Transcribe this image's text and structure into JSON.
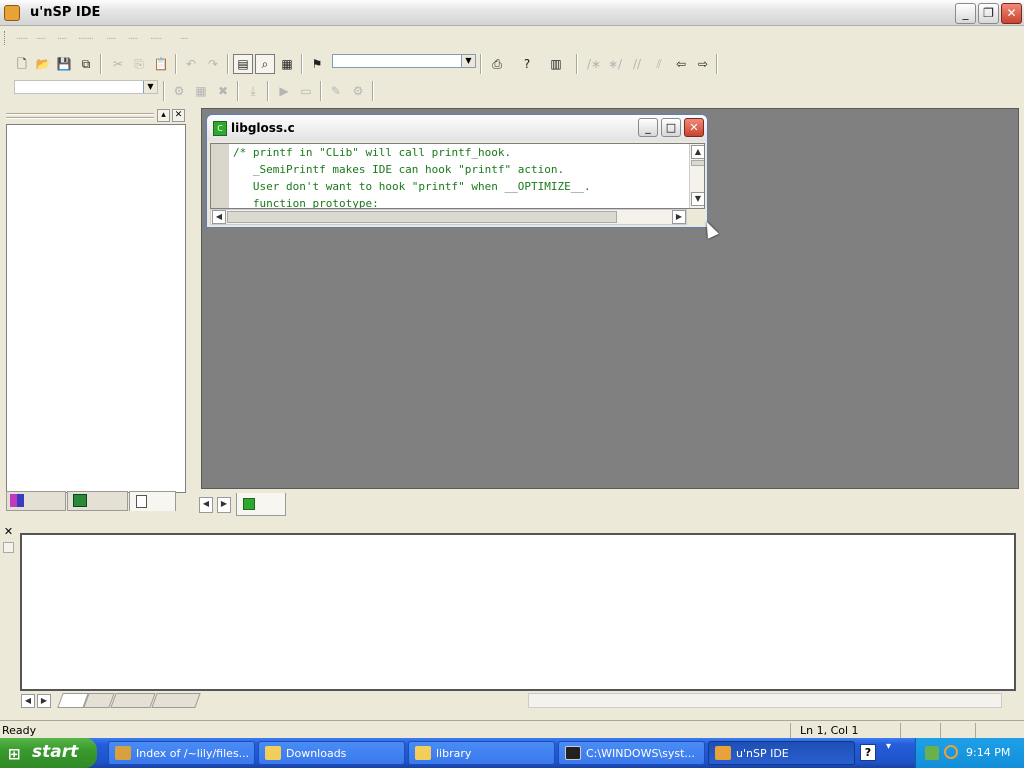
{
  "window": {
    "title": "u'nSP IDE"
  },
  "menubar": {
    "items": [
      "......",
      ".....",
      ".....",
      "........",
      ".....",
      ".....",
      "......",
      "...."
    ]
  },
  "toolbar1": {
    "icons": [
      "new-icon",
      "open-icon",
      "save-icon",
      "save-all-icon",
      "cut-icon",
      "copy-icon",
      "paste-icon",
      "undo-icon",
      "redo-icon",
      "workspace-icon",
      "find-in-files-icon",
      "output-icon",
      "bookmark-icon",
      "print-icon",
      "help-icon",
      "chart-icon",
      "comment-icon",
      "uncomment-icon",
      "indent-icon",
      "outdent-icon",
      "back-icon",
      "forward-icon"
    ]
  },
  "editor": {
    "filename": "libgloss.c",
    "file_icon": "C",
    "lines": [
      "/* printf in \"CLib\" will call printf_hook.",
      "   _SemiPrintf makes IDE can hook \"printf\" action.",
      "   User don't want to hook \"printf\" when __OPTIMIZE__.",
      "   function prototype:"
    ]
  },
  "status": {
    "text": "Ready",
    "position": "Ln 1, Col 1"
  },
  "taskbar": {
    "start_label": "start",
    "tasks": [
      {
        "label": "Index of /~lily/files..."
      },
      {
        "label": "Downloads"
      },
      {
        "label": "library"
      },
      {
        "label": "C:\\WINDOWS\\syst..."
      },
      {
        "label": "u'nSP IDE"
      }
    ],
    "clock": "9:14 PM"
  },
  "colors": {
    "code": "#1a7a1a",
    "mdi_bg": "#808080",
    "taskbar": "#245edb"
  }
}
